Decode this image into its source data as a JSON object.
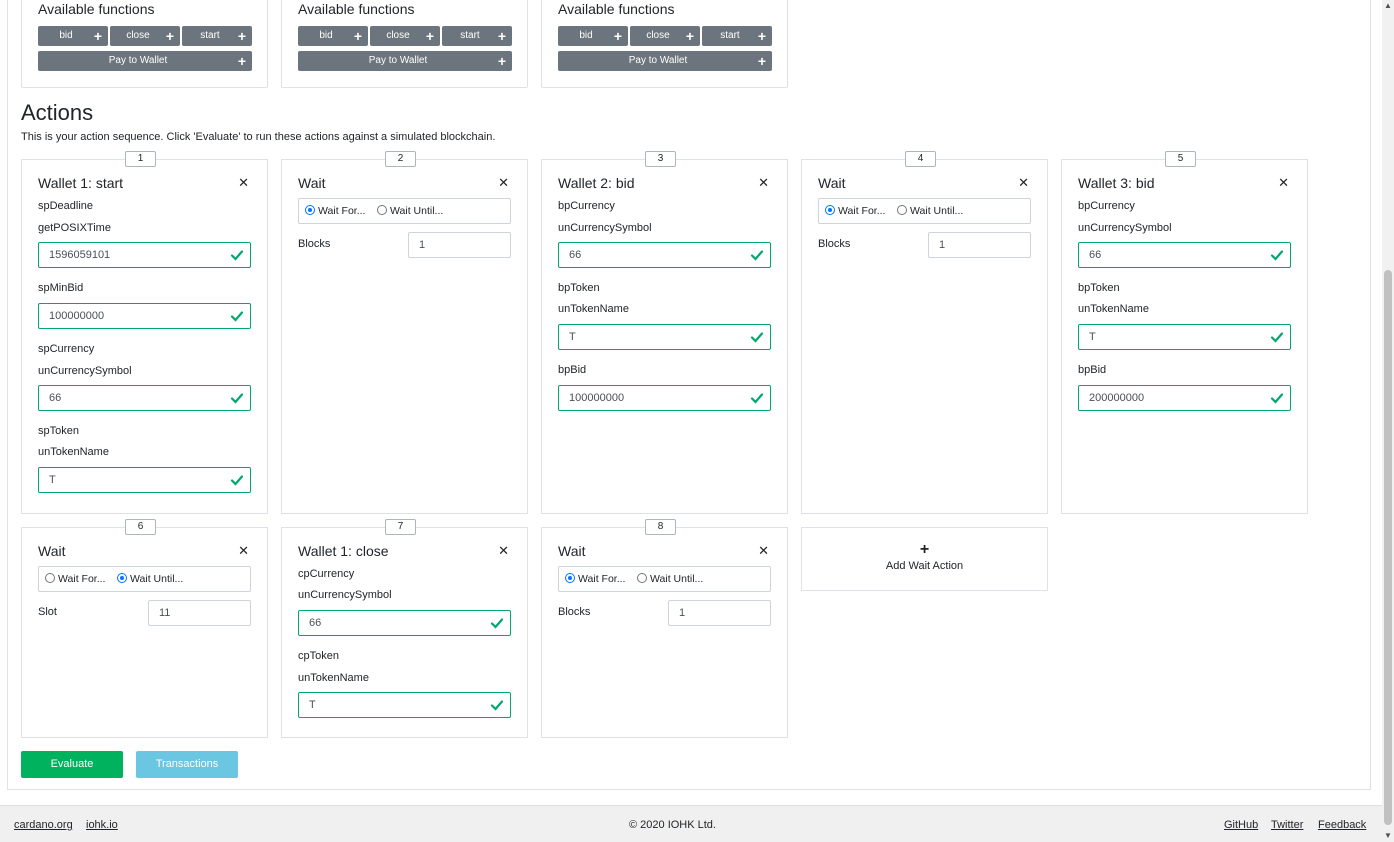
{
  "wallet_functions": {
    "title": "Available functions",
    "cards": [
      {
        "bid": "bid",
        "close": "close",
        "start": "start",
        "pay": "Pay to Wallet"
      },
      {
        "bid": "bid",
        "close": "close",
        "start": "start",
        "pay": "Pay to Wallet"
      },
      {
        "bid": "bid",
        "close": "close",
        "start": "start",
        "pay": "Pay to Wallet"
      }
    ]
  },
  "actions": {
    "title": "Actions",
    "description": "This is your action sequence. Click 'Evaluate' to run these actions against a simulated blockchain."
  },
  "cards": {
    "c1": {
      "index": "1",
      "title": "Wallet 1: start",
      "l1": "spDeadline",
      "l2": "getPOSIXTime",
      "v1": "1596059101",
      "l3": "spMinBid",
      "v2": "100000000",
      "l4": "spCurrency",
      "l5": "unCurrencySymbol",
      "v3": "66",
      "l6": "spToken",
      "l7": "unTokenName",
      "v4": "T"
    },
    "c2": {
      "index": "2",
      "title": "Wait",
      "opt_for": "Wait For...",
      "opt_until": "Wait Until...",
      "field_label": "Blocks",
      "field_value": "1"
    },
    "c3": {
      "index": "3",
      "title": "Wallet 2: bid",
      "l1": "bpCurrency",
      "l2": "unCurrencySymbol",
      "v1": "66",
      "l3": "bpToken",
      "l4": "unTokenName",
      "v2": "T",
      "l5": "bpBid",
      "v3": "100000000"
    },
    "c4": {
      "index": "4",
      "title": "Wait",
      "opt_for": "Wait For...",
      "opt_until": "Wait Until...",
      "field_label": "Blocks",
      "field_value": "1"
    },
    "c5": {
      "index": "5",
      "title": "Wallet 3: bid",
      "l1": "bpCurrency",
      "l2": "unCurrencySymbol",
      "v1": "66",
      "l3": "bpToken",
      "l4": "unTokenName",
      "v2": "T",
      "l5": "bpBid",
      "v3": "200000000"
    },
    "c6": {
      "index": "6",
      "title": "Wait",
      "opt_for": "Wait For...",
      "opt_until": "Wait Until...",
      "field_label": "Slot",
      "field_value": "11"
    },
    "c7": {
      "index": "7",
      "title": "Wallet 1: close",
      "l1": "cpCurrency",
      "l2": "unCurrencySymbol",
      "v1": "66",
      "l3": "cpToken",
      "l4": "unTokenName",
      "v2": "T"
    },
    "c8": {
      "index": "8",
      "title": "Wait",
      "opt_for": "Wait For...",
      "opt_until": "Wait Until...",
      "field_label": "Blocks",
      "field_value": "1"
    }
  },
  "add_wait": {
    "label": "Add Wait Action"
  },
  "buttons": {
    "evaluate": "Evaluate",
    "transactions": "Transactions"
  },
  "footer": {
    "links_left": [
      "cardano.org",
      "iohk.io"
    ],
    "copyright": "© 2020 IOHK Ltd.",
    "links_right": [
      "GitHub",
      "Twitter",
      "Feedback"
    ]
  },
  "colors": {
    "valid": "#00a86b",
    "evaluate": "#00b15d",
    "transactions": "#5bc0de",
    "function_button": "#6c757d"
  },
  "icons": {
    "check": "check-icon",
    "close": "close-icon",
    "plus": "plus-icon"
  }
}
